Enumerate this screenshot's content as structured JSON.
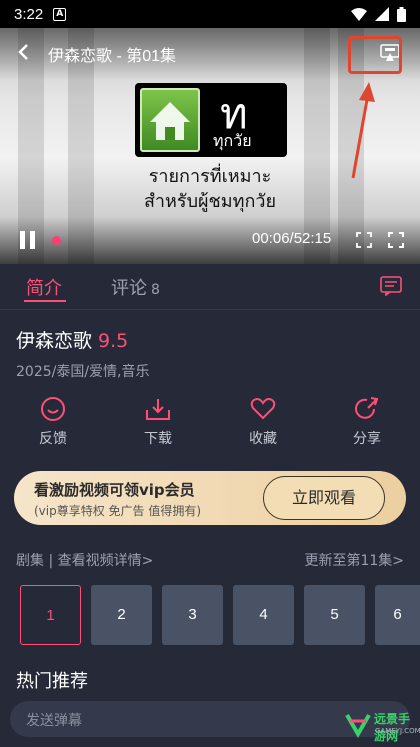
{
  "status_bar": {
    "time": "3:22",
    "badge": "A"
  },
  "player": {
    "title": "伊森恋歌 - 第01集",
    "current_time": "00:06",
    "total_time": "52:15",
    "time_display": "00:06/52:15",
    "progress_fraction": 0.002,
    "logo_big": "ท",
    "logo_small": "ทุกวัย",
    "rating_line1": "รายการที่เหมาะ",
    "rating_line2": "สำหรับผู้ชมทุกวัย"
  },
  "tabs": [
    {
      "label": "简介",
      "active": true
    },
    {
      "label": "评论",
      "count": "8",
      "active": false
    }
  ],
  "show": {
    "title": "伊森恋歌",
    "score": "9.5",
    "meta": "2025/泰国/爱情,音乐"
  },
  "actions": [
    {
      "label": "反馈",
      "icon": "feedback-icon"
    },
    {
      "label": "下载",
      "icon": "download-icon"
    },
    {
      "label": "收藏",
      "icon": "heart-icon"
    },
    {
      "label": "分享",
      "icon": "share-icon"
    }
  ],
  "vip_banner": {
    "title": "看激励视频可领vip会员",
    "subtitle": "(vip尊享特权 免广告 值得拥有)",
    "button": "立即观看"
  },
  "episodes": {
    "header": "剧集 | 查看视频详情>",
    "update": "更新至第11集>",
    "visible": [
      "1",
      "2",
      "3",
      "4",
      "5",
      "6"
    ],
    "active_index": 0
  },
  "recommend_title": "热门推荐",
  "danmu_input": {
    "placeholder": "发送弹幕"
  },
  "watermark": {
    "title": "远景手游网",
    "url": "GAMEYJ.COM"
  },
  "colors": {
    "accent": "#ff4f79",
    "background": "#262a38",
    "highlight": "#e0452f",
    "vip": "#f3ddb5"
  }
}
